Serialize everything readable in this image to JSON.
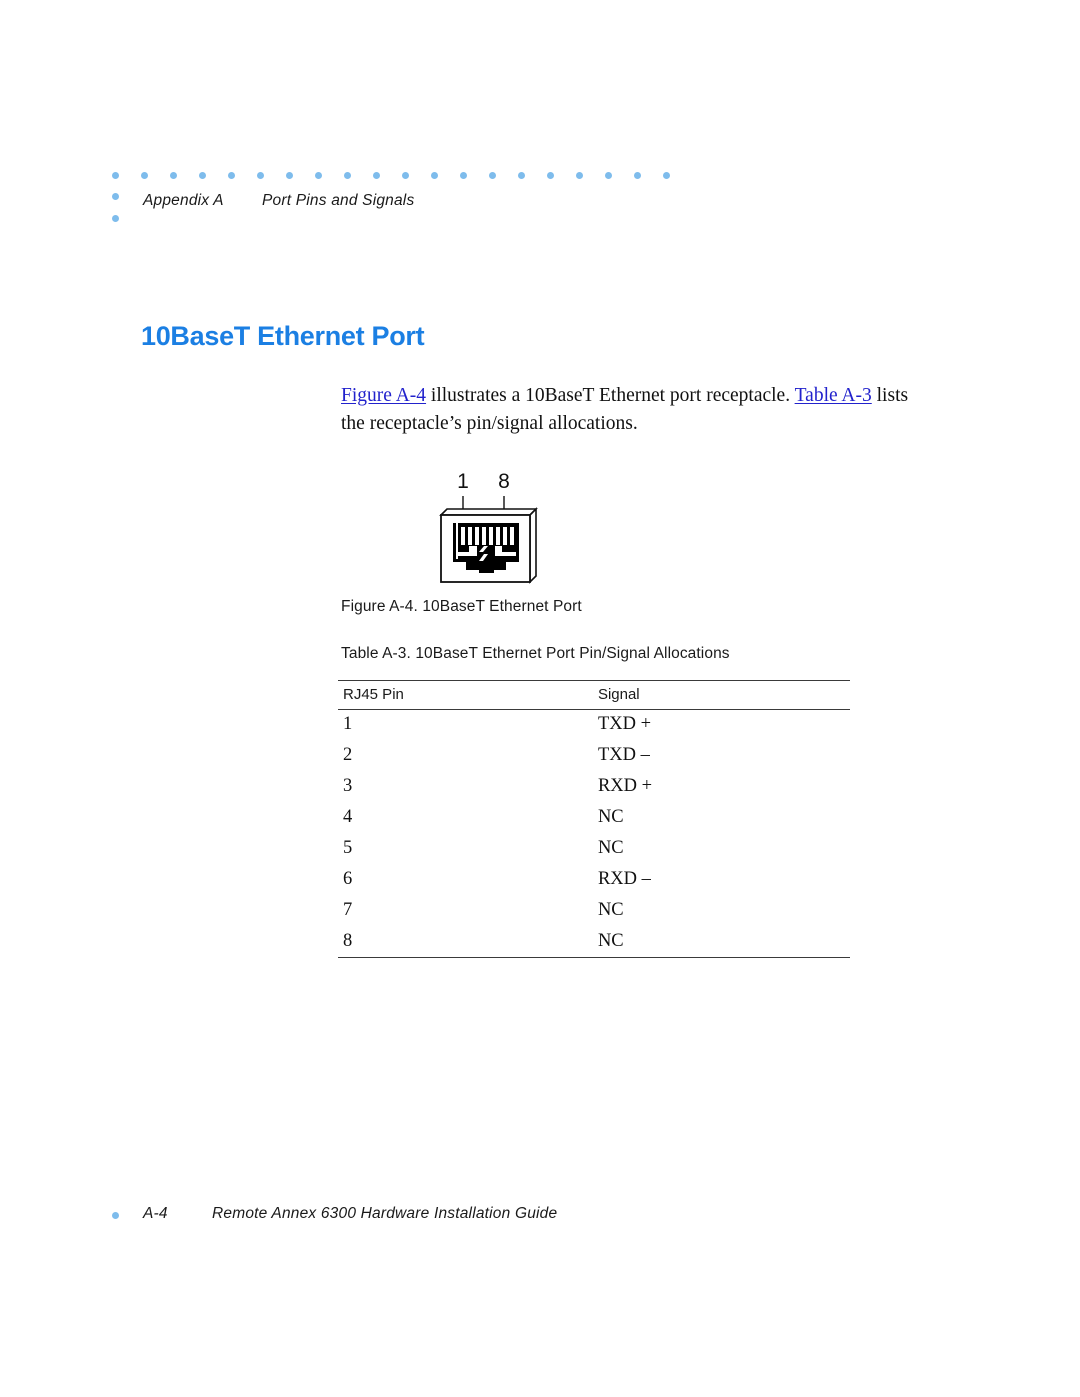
{
  "header": {
    "appendix": "Appendix A",
    "section": "Port Pins and Signals",
    "dot_color": "#7EBCEC",
    "dot_count_row": 20,
    "dot_count_column": 2
  },
  "heading": {
    "text": "10BaseT Ethernet Port",
    "color": "#1B7FE3"
  },
  "body": {
    "link_figure": "Figure A-4",
    "text_part1": " illustrates a 10BaseT Ethernet port receptacle. ",
    "link_table": "Table A-3",
    "text_part2": " lists the receptacle’s pin/signal allocations.",
    "link_color": "#2222CC"
  },
  "figure": {
    "name": "rj45-receptacle-diagram",
    "label_left": "1",
    "label_right": "8",
    "pin_slots": 8,
    "caption": "Figure A-4. 10BaseT Ethernet Port"
  },
  "table": {
    "caption": "Table A-3. 10BaseT Ethernet Port Pin/Signal Allocations",
    "columns": [
      "RJ45 Pin",
      "Signal"
    ],
    "rows": [
      [
        "1",
        "TXD +"
      ],
      [
        "2",
        "TXD –"
      ],
      [
        "3",
        "RXD +"
      ],
      [
        "4",
        "NC"
      ],
      [
        "5",
        "NC"
      ],
      [
        "6",
        "RXD –"
      ],
      [
        "7",
        "NC"
      ],
      [
        "8",
        "NC"
      ]
    ]
  },
  "footer": {
    "page_number": "A-4",
    "guide_title": "Remote Annex 6300 Hardware Installation Guide",
    "dot_color": "#7EBCEC"
  }
}
